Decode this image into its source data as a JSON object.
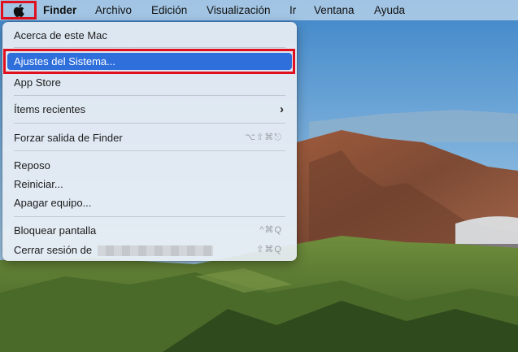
{
  "menubar": {
    "apple_icon": "apple-logo",
    "app_name": "Finder",
    "items": [
      "Archivo",
      "Edición",
      "Visualización",
      "Ir",
      "Ventana",
      "Ayuda"
    ]
  },
  "apple_menu": {
    "items": [
      {
        "label": "Acerca de este Mac",
        "shortcut": ""
      },
      {
        "label": "Ajustes del Sistema...",
        "shortcut": "",
        "highlighted": true
      },
      {
        "label": "App Store",
        "shortcut": ""
      },
      {
        "label": "Ítems recientes",
        "shortcut": "",
        "submenu": true
      },
      {
        "label": "Forzar salida de Finder",
        "shortcut": "⌥⇧⌘⎋"
      },
      {
        "label": "Reposo",
        "shortcut": ""
      },
      {
        "label": "Reiniciar...",
        "shortcut": ""
      },
      {
        "label": "Apagar equipo...",
        "shortcut": ""
      },
      {
        "label": "Bloquear pantalla",
        "shortcut": "^⌘Q"
      },
      {
        "label": "Cerrar sesión de",
        "shortcut": "⇧⌘Q"
      }
    ]
  },
  "colors": {
    "highlight": "#2f6fdc",
    "annotation_red": "#e0101e"
  }
}
